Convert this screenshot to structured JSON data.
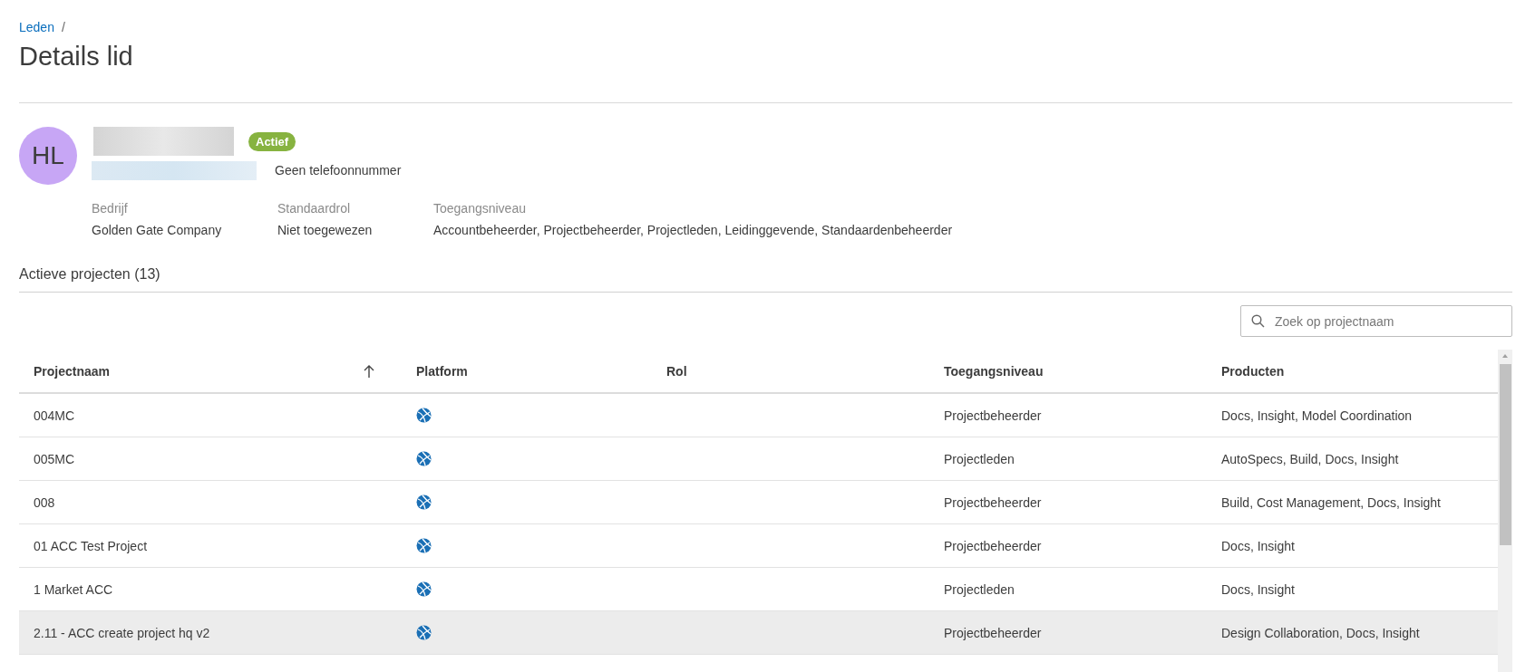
{
  "breadcrumb": {
    "link": "Leden",
    "separator": "/"
  },
  "title": "Details lid",
  "member": {
    "initials": "HL",
    "status": "Actief",
    "active": true,
    "phone": "Geen telefoonnummer"
  },
  "fields": [
    {
      "label": "Bedrijf",
      "value": "Golden Gate Company"
    },
    {
      "label": "Standaardrol",
      "value": "Niet toegewezen"
    },
    {
      "label": "Toegangsniveau",
      "value": "Accountbeheerder, Projectbeheerder, Projectleden, Leidinggevende, Standaardenbeheerder"
    }
  ],
  "section_title": "Actieve projecten (13)",
  "search": {
    "placeholder": "Zoek op projectnaam"
  },
  "table": {
    "columns": [
      {
        "label": "Projectnaam",
        "sorted": true
      },
      {
        "label": "Platform",
        "sorted": false
      },
      {
        "label": "Rol",
        "sorted": false
      },
      {
        "label": "Toegangsniveau",
        "sorted": false
      },
      {
        "label": "Producten",
        "sorted": false
      }
    ],
    "rows": [
      {
        "name": "004MC",
        "access": "Projectbeheerder",
        "products": "Docs, Insight, Model Coordination",
        "highlighted": false
      },
      {
        "name": "005MC",
        "access": "Projectleden",
        "products": "AutoSpecs, Build, Docs, Insight",
        "highlighted": false
      },
      {
        "name": "008",
        "access": "Projectbeheerder",
        "products": "Build, Cost Management, Docs, Insight",
        "highlighted": false
      },
      {
        "name": "01 ACC Test Project",
        "access": "Projectbeheerder",
        "products": "Docs, Insight",
        "highlighted": false
      },
      {
        "name": "1 Market ACC",
        "access": "Projectleden",
        "products": "Docs, Insight",
        "highlighted": false
      },
      {
        "name": "2.11 - ACC create project hq v2",
        "access": "Projectbeheerder",
        "products": "Design Collaboration, Docs, Insight",
        "highlighted": true
      }
    ]
  }
}
